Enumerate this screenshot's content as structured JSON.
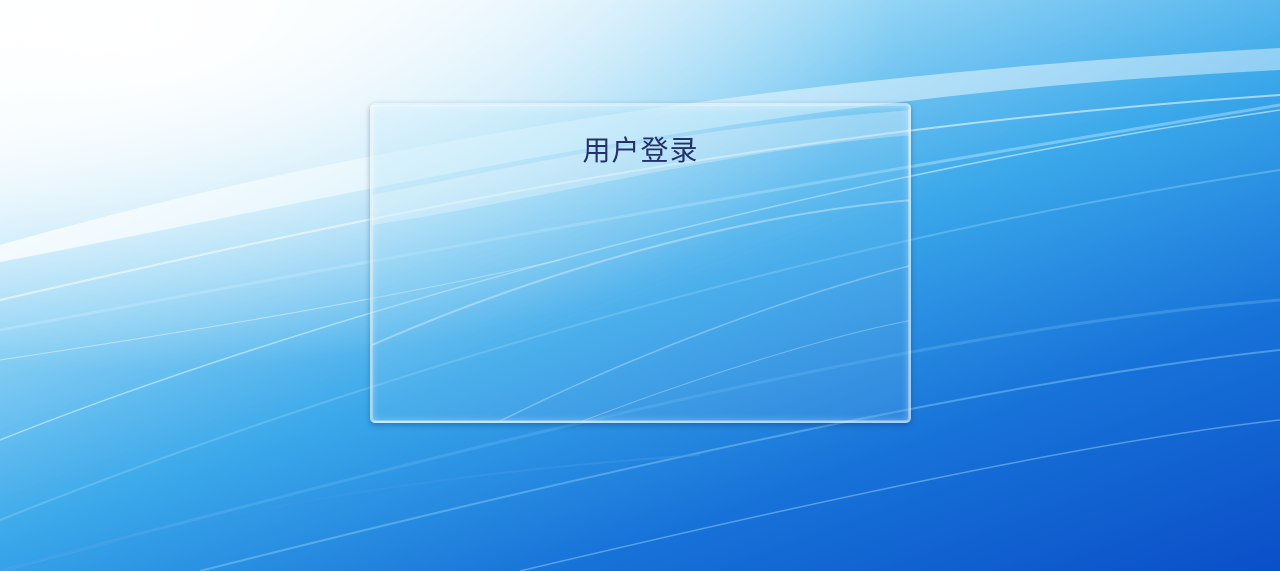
{
  "login_panel": {
    "title": "用户登录"
  },
  "colors": {
    "background_light": "#ffffff",
    "background_mid": "#3aa8ea",
    "background_dark": "#0a4fc8",
    "title_text": "#23306a"
  }
}
